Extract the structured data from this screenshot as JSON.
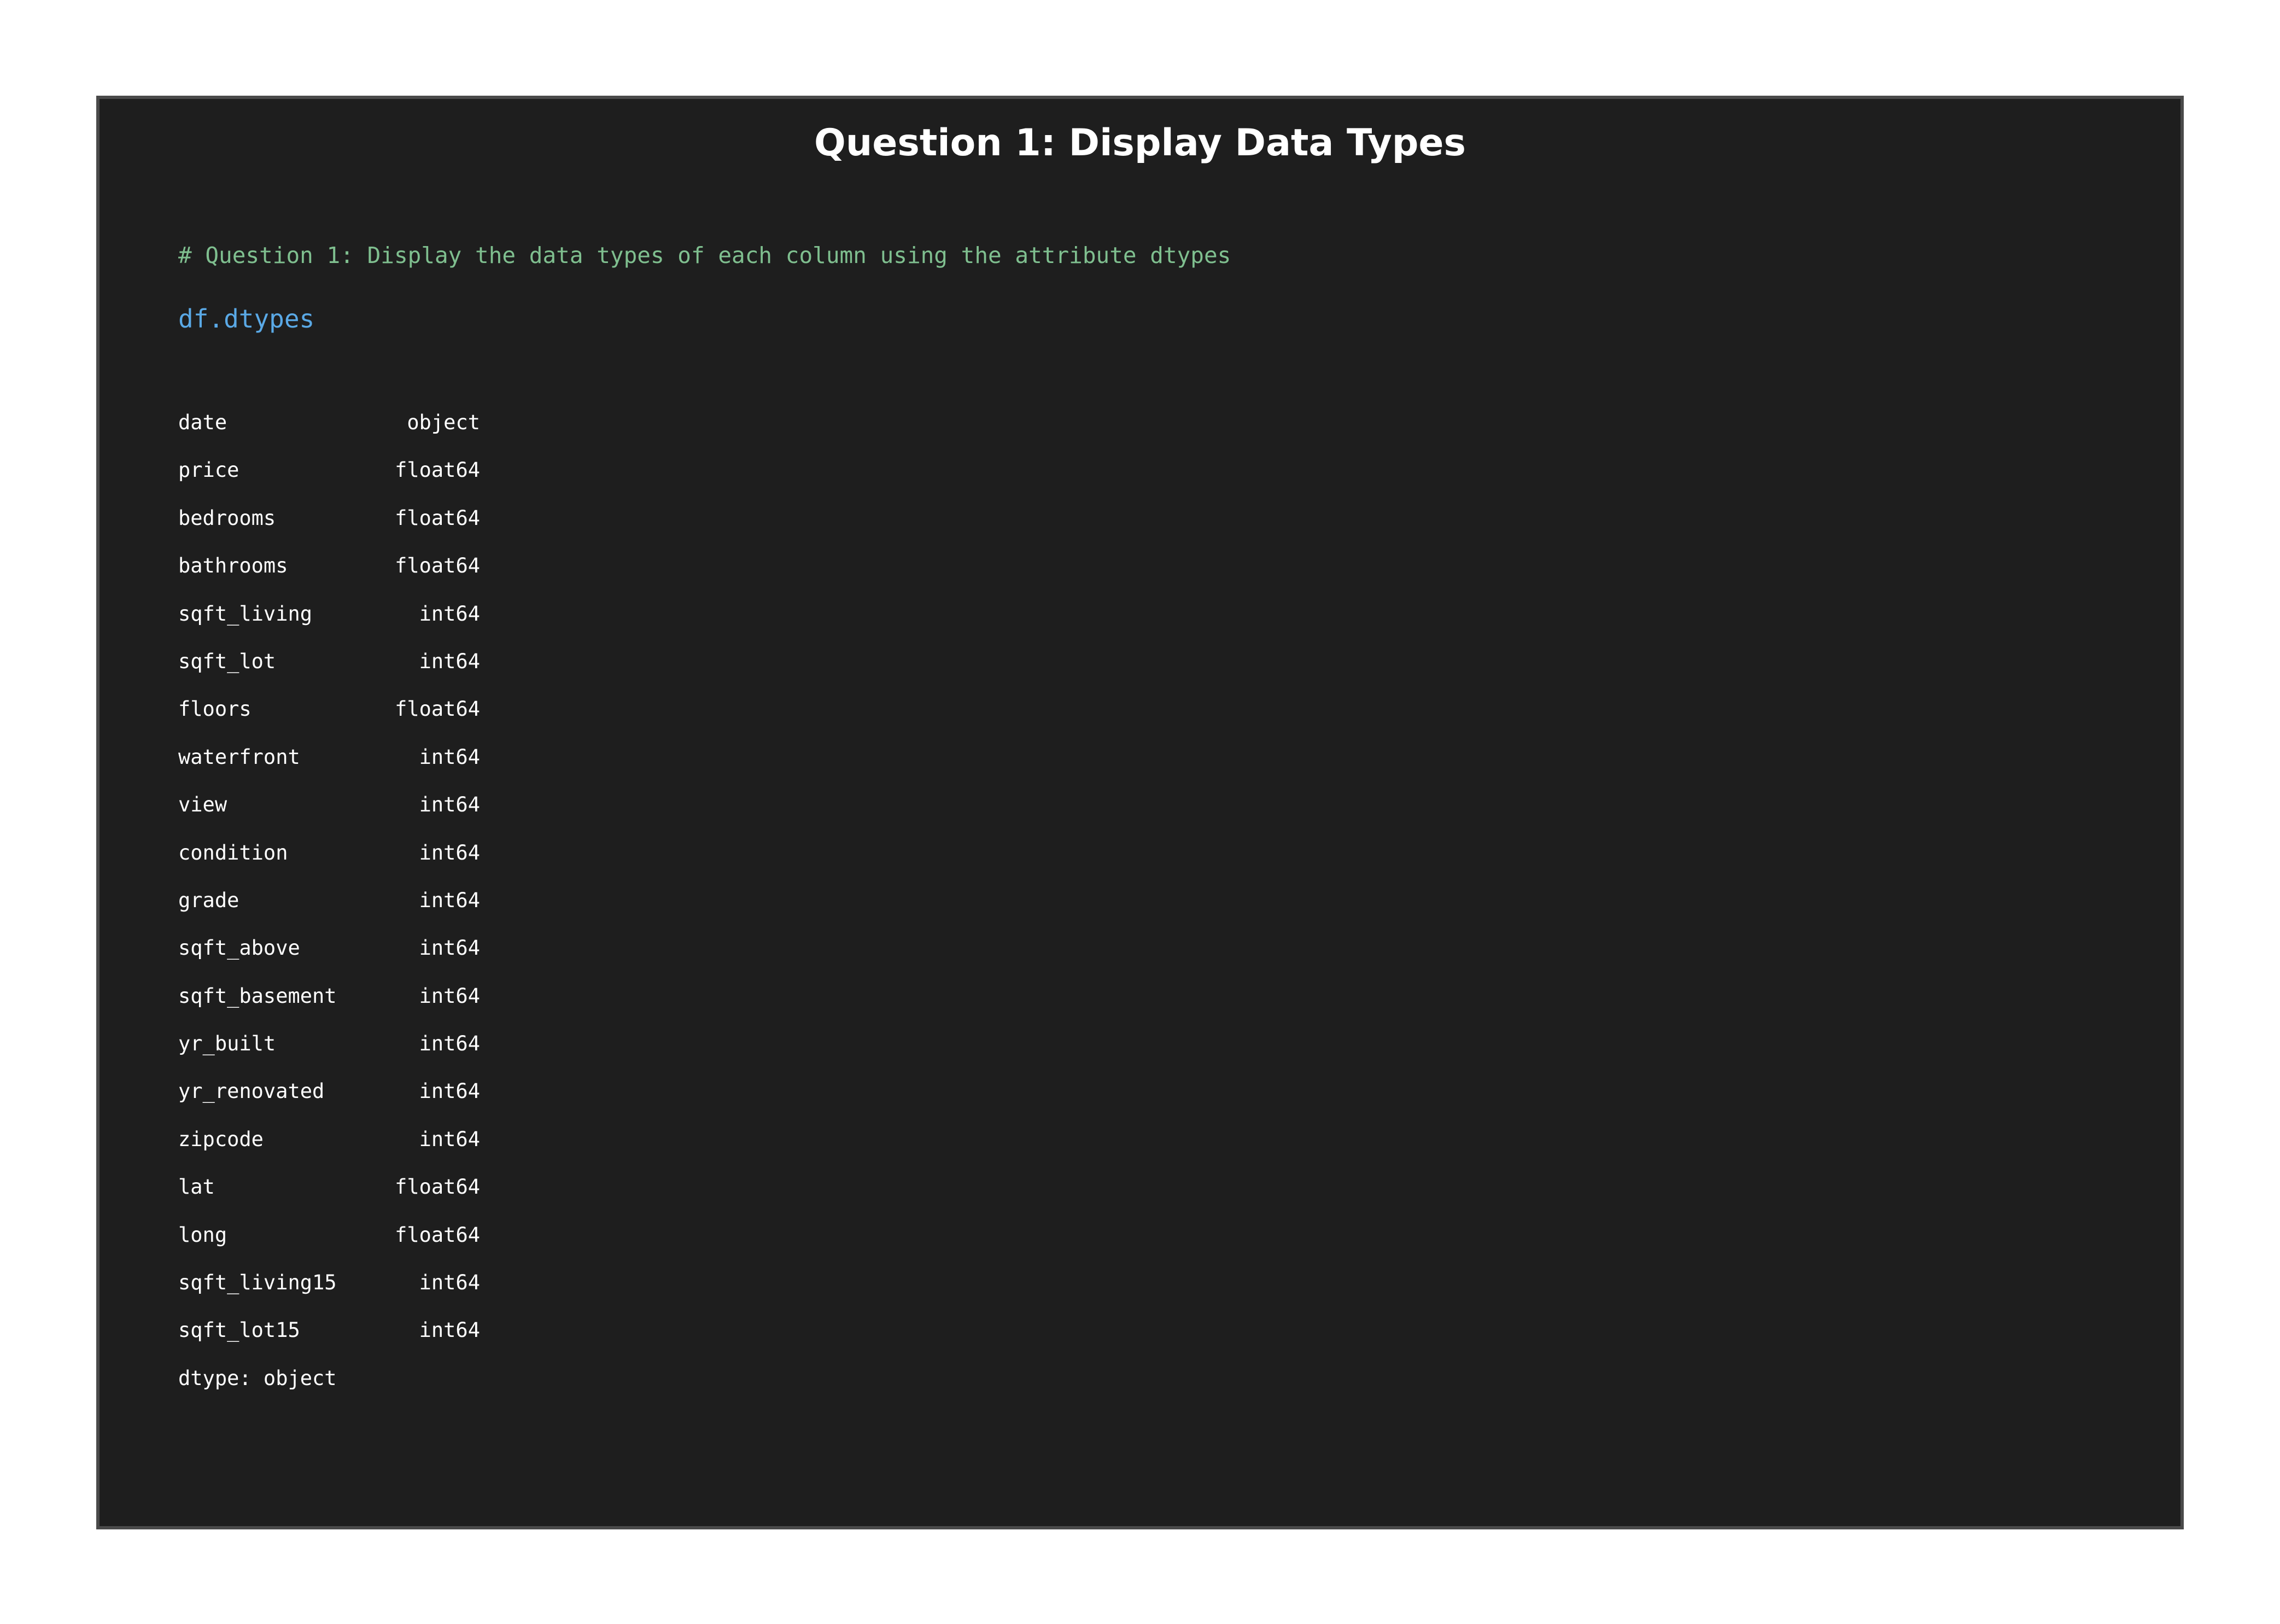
{
  "title": "Question 1: Display Data Types",
  "cell": {
    "comment": "# Question 1: Display the data types of each column using the attribute dtypes",
    "code": "df.dtypes"
  },
  "output": {
    "rows": [
      {
        "column": "date",
        "dtype": "object"
      },
      {
        "column": "price",
        "dtype": "float64"
      },
      {
        "column": "bedrooms",
        "dtype": "float64"
      },
      {
        "column": "bathrooms",
        "dtype": "float64"
      },
      {
        "column": "sqft_living",
        "dtype": "int64"
      },
      {
        "column": "sqft_lot",
        "dtype": "int64"
      },
      {
        "column": "floors",
        "dtype": "float64"
      },
      {
        "column": "waterfront",
        "dtype": "int64"
      },
      {
        "column": "view",
        "dtype": "int64"
      },
      {
        "column": "condition",
        "dtype": "int64"
      },
      {
        "column": "grade",
        "dtype": "int64"
      },
      {
        "column": "sqft_above",
        "dtype": "int64"
      },
      {
        "column": "sqft_basement",
        "dtype": "int64"
      },
      {
        "column": "yr_built",
        "dtype": "int64"
      },
      {
        "column": "yr_renovated",
        "dtype": "int64"
      },
      {
        "column": "zipcode",
        "dtype": "int64"
      },
      {
        "column": "lat",
        "dtype": "float64"
      },
      {
        "column": "long",
        "dtype": "float64"
      },
      {
        "column": "sqft_living15",
        "dtype": "int64"
      },
      {
        "column": "sqft_lot15",
        "dtype": "int64"
      }
    ],
    "footer": "dtype: object"
  },
  "colors": {
    "panel_background": "#1e1e1e",
    "panel_border": "#4a4a4a",
    "comment": "#7fbf8f",
    "code": "#5aa9e6",
    "text": "#ffffff"
  }
}
